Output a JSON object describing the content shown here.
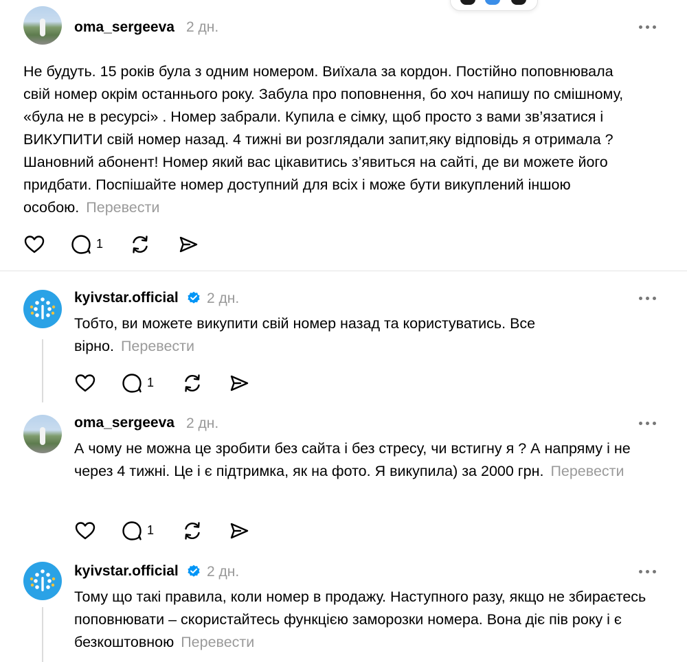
{
  "posts": [
    {
      "username": "oma_sergeeva",
      "time": "2 дн.",
      "text": "Не будуть. 15 років була з одним номером. Виїхала за кордон. Постійно поповнювала свій номер окрім останнього року. Забула про поповнення, бо хоч напишу по смішному, «була не в ресурсі» . Номер забрали. Купила е сімку, щоб просто з вами зв’язатися і ВИКУПИТИ свій номер назад. 4 тижні ви розглядали запит,яку відповідь я отримала ? Шановний абонент! Номер який вас цікавитись з’явиться на сайті, де ви можете його придбати. Поспішайте номер доступний для всіх і може бути викуплений іншою особою.",
      "translate": "Перевести",
      "reply_count": "1"
    },
    {
      "username": "kyivstar.official",
      "time": "2 дн.",
      "text": "Тобто, ви можете викупити свій номер назад та користуватись. Все вірно.",
      "translate": "Перевести",
      "reply_count": "1"
    },
    {
      "username": "oma_sergeeva",
      "time": "2 дн.",
      "text": "А чому не можна це зробити без сайта і без стресу, чи встигну я ? А напряму і не через 4 тижні. Це і є підтримка, як на фото. Я викупила) за 2000 грн.",
      "translate": "Перевести",
      "reply_count": "1"
    },
    {
      "username": "kyivstar.official",
      "time": "2 дн.",
      "text": "Тому що такі правила, коли номер в продажу. Наступного разу, якщо не збираєтесь поповнювати – скористайтесь функцією заморозки номера. Вона діє пів року і є безкоштовною",
      "translate": "Перевести"
    }
  ],
  "icons": {
    "like": "heart-icon",
    "reply": "comment-icon",
    "repost": "repost-icon",
    "share": "send-icon",
    "more": "more-icon",
    "verified": "verified-badge-icon"
  },
  "colors": {
    "verified": "#0095f6",
    "kyivstar": "#2aa2e6",
    "muted": "#999999"
  }
}
